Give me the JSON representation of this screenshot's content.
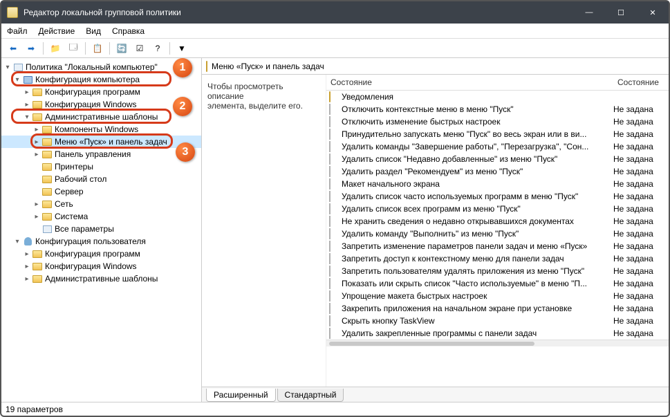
{
  "window": {
    "title": "Редактор локальной групповой политики"
  },
  "menu": {
    "file": "Файл",
    "action": "Действие",
    "view": "Вид",
    "help": "Справка"
  },
  "tree": {
    "root": "Политика \"Локальный компьютер\"",
    "comp_config": "Конфигурация компьютера",
    "prog_config": "Конфигурация программ",
    "win_config": "Конфигурация Windows",
    "admin_tmpl": "Административные шаблоны",
    "components": "Компоненты Windows",
    "start_taskbar": "Меню «Пуск» и панель задач",
    "control_panel": "Панель управления",
    "printers": "Принтеры",
    "desktop": "Рабочий стол",
    "server": "Сервер",
    "network": "Сеть",
    "system": "Система",
    "all_params": "Все параметры",
    "user_config": "Конфигурация пользователя",
    "u_prog_config": "Конфигурация программ",
    "u_win_config": "Конфигурация Windows",
    "u_admin_tmpl": "Административные шаблоны"
  },
  "content": {
    "title": "Меню «Пуск» и панель задач",
    "hint": "Чтобы просмотреть описание элемента, выделите его.",
    "hint_prefix": "Чтобы просмотреть описание",
    "hint_suffix": "элемента, выделите его.",
    "col_state": "Состояние",
    "not_set": "Не задана"
  },
  "items": [
    {
      "name": "Уведомления",
      "folder": true
    },
    {
      "name": "Отключить контекстные меню в меню \"Пуск\""
    },
    {
      "name": "Отключить изменение быстрых настроек"
    },
    {
      "name": "Принудительно запускать меню \"Пуск\" во весь экран или в ви..."
    },
    {
      "name": "Удалить команды \"Завершение работы\", \"Перезагрузка\", \"Сон..."
    },
    {
      "name": "Удалить список \"Недавно добавленные\" из меню \"Пуск\""
    },
    {
      "name": "Удалить раздел \"Рекомендуем\" из меню \"Пуск\""
    },
    {
      "name": "Макет начального экрана"
    },
    {
      "name": "Удалить список часто используемых программ в меню \"Пуск\""
    },
    {
      "name": "Удалить список всех программ из меню \"Пуск\""
    },
    {
      "name": "Не хранить сведения о недавно открывавшихся документах"
    },
    {
      "name": "Удалить команду \"Выполнить\" из меню \"Пуск\""
    },
    {
      "name": "Запретить изменение параметров панели задач и меню «Пуск»"
    },
    {
      "name": "Запретить доступ к контекстному меню для панели задач"
    },
    {
      "name": "Запретить пользователям удалять приложения из меню \"Пуск\""
    },
    {
      "name": "Показать или скрыть список \"Часто используемые\" в меню \"П..."
    },
    {
      "name": "Упрощение макета быстрых настроек"
    },
    {
      "name": "Закрепить приложения на начальном экране при установке"
    },
    {
      "name": "Скрыть кнопку TaskView"
    },
    {
      "name": "Удалить закрепленные программы с панели задач"
    }
  ],
  "tabs": {
    "extended": "Расширенный",
    "standard": "Стандартный"
  },
  "status": "19 параметров"
}
